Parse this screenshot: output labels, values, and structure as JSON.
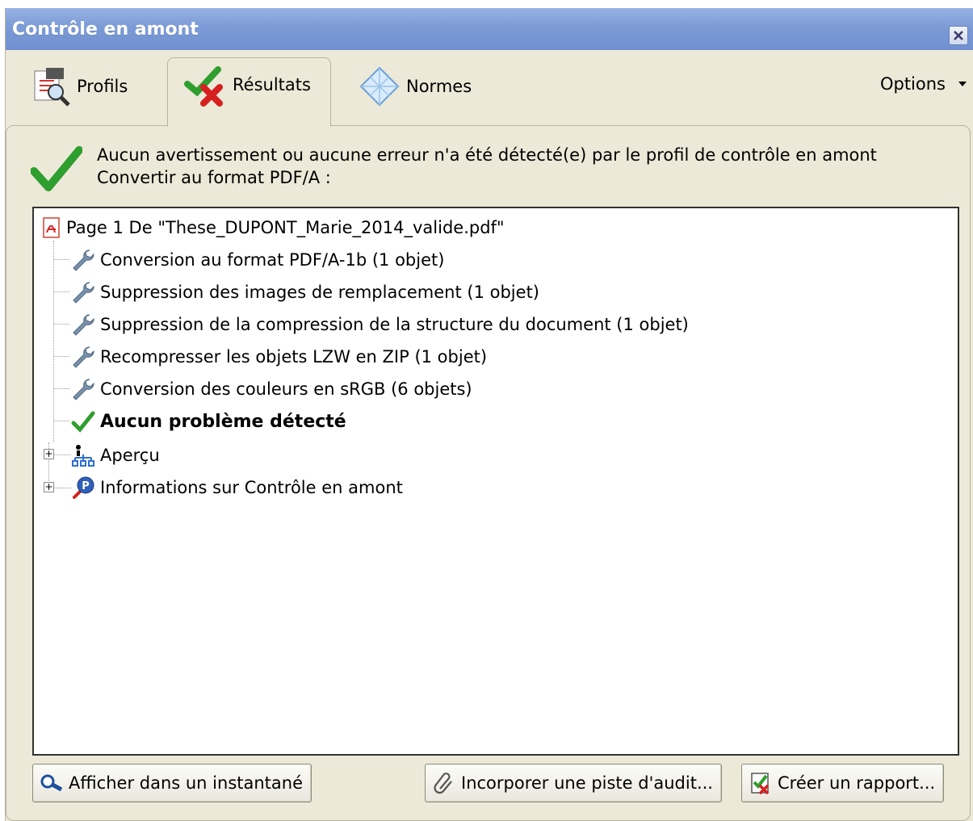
{
  "window": {
    "title": "Contrôle en amont"
  },
  "tabs": [
    {
      "label": "Profils",
      "icon": "preflight-profiles-icon",
      "active": false
    },
    {
      "label": "Résultats",
      "icon": "check-cross-results-icon",
      "active": true
    },
    {
      "label": "Normes",
      "icon": "diamond-standards-icon",
      "active": false
    }
  ],
  "options": {
    "label": "Options"
  },
  "summary": {
    "line1": "Aucun avertissement ou aucune erreur n'a été détecté(e) par le profil de contrôle en amont",
    "line2": "Convertir au format PDF/A :",
    "icon": "green-check-icon"
  },
  "tree": {
    "root": {
      "label": "Page 1 De \"These_DUPONT_Marie_2014_valide.pdf\"",
      "icon": "pdf-page-icon"
    },
    "fixups": [
      {
        "label": "Conversion au format PDF/A-1b (1 objet)",
        "icon": "wrench-icon"
      },
      {
        "label": "Suppression des images de remplacement (1 objet)",
        "icon": "wrench-icon"
      },
      {
        "label": "Suppression de la compression de la structure du document (1 objet)",
        "icon": "wrench-icon"
      },
      {
        "label": "Recompresser les objets LZW en ZIP (1 objet)",
        "icon": "wrench-icon"
      },
      {
        "label": "Conversion des couleurs en sRGB (6 objets)",
        "icon": "wrench-icon"
      }
    ],
    "status": {
      "label": "Aucun problème détecté",
      "icon": "green-check-icon"
    },
    "nodes": [
      {
        "label": "Aperçu",
        "icon": "hierarchy-icon",
        "expander": "+"
      },
      {
        "label": "Informations sur Contrôle en amont",
        "icon": "preflight-info-icon",
        "expander": "+"
      }
    ]
  },
  "buttons": {
    "snapshot": "Afficher dans un instantané",
    "audit": "Incorporer une piste d'audit...",
    "report": "Créer un rapport..."
  },
  "colors": {
    "titlebar": "#7c9bd6",
    "panel": "#ECE9D8",
    "check": "#2e9e2e",
    "error": "#d62020"
  }
}
